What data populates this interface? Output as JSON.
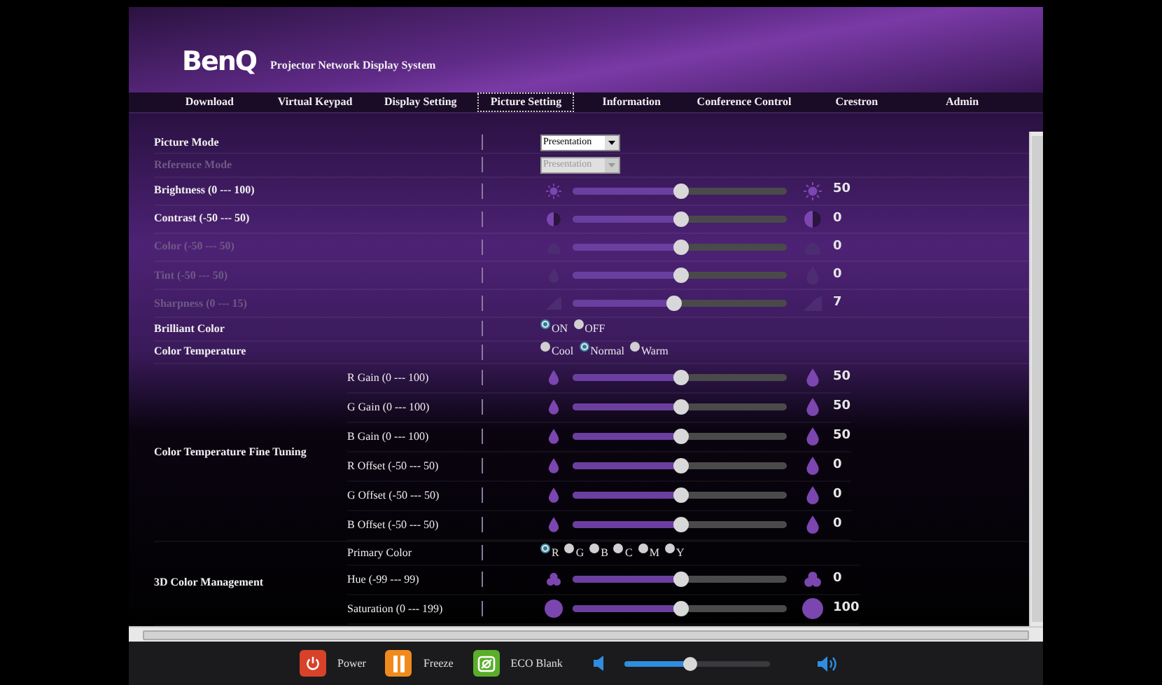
{
  "header": {
    "logo": "BenQ",
    "subtitle": "Projector Network Display System"
  },
  "tabs": [
    {
      "label": "Download",
      "selected": false
    },
    {
      "label": "Virtual Keypad",
      "selected": false
    },
    {
      "label": "Display Setting",
      "selected": false
    },
    {
      "label": "Picture Setting",
      "selected": true
    },
    {
      "label": "Information",
      "selected": false
    },
    {
      "label": "Conference Control",
      "selected": false
    },
    {
      "label": "Crestron",
      "selected": false
    },
    {
      "label": "Admin",
      "selected": false
    }
  ],
  "rows": [
    {
      "kind": "select",
      "label": "Picture Mode",
      "value": "Presentation",
      "disabled": false
    },
    {
      "kind": "select",
      "label": "Reference Mode",
      "value": "Presentation",
      "disabled": true
    },
    {
      "kind": "brightness",
      "label": "Brightness (0 --- 100)",
      "level": 0.5,
      "reading": "50",
      "disabled": false
    },
    {
      "kind": "contrast",
      "label": "Contrast (-50 --- 50)",
      "level": 0.5,
      "reading": "0",
      "disabled": false
    },
    {
      "kind": "color",
      "label": "Color (-50 --- 50)",
      "level": 0.5,
      "reading": "0",
      "disabled": true
    },
    {
      "kind": "tint",
      "label": "Tint (-50 --- 50)",
      "level": 0.5,
      "reading": "0",
      "disabled": true
    },
    {
      "kind": "sharpness",
      "label": "Sharpness (0 --- 15)",
      "level": 0.47,
      "reading": "7",
      "disabled": true
    },
    {
      "kind": "radio",
      "label": "Brilliant Color",
      "options": [
        {
          "label": "ON",
          "selected": true
        },
        {
          "label": "OFF",
          "selected": false
        }
      ]
    },
    {
      "kind": "radio",
      "label": "Color Temperature",
      "options": [
        {
          "label": "Cool",
          "selected": false
        },
        {
          "label": "Normal",
          "selected": true
        },
        {
          "label": "Warm",
          "selected": false
        }
      ]
    },
    {
      "kind": "group",
      "label": "Color Temperature Fine Tuning",
      "children": [
        {
          "kind": "tint",
          "label": "R Gain (0 --- 100)",
          "level": 0.5,
          "reading": "50",
          "disabled": false
        },
        {
          "kind": "tint",
          "label": "G Gain (0 --- 100)",
          "level": 0.5,
          "reading": "50",
          "disabled": false
        },
        {
          "kind": "tint",
          "label": "B Gain (0 --- 100)",
          "level": 0.5,
          "reading": "50",
          "disabled": false
        },
        {
          "kind": "tint",
          "label": "R Offset (-50 --- 50)",
          "level": 0.5,
          "reading": "0",
          "disabled": false
        },
        {
          "kind": "tint",
          "label": "G Offset (-50 --- 50)",
          "level": 0.5,
          "reading": "0",
          "disabled": false
        },
        {
          "kind": "tint",
          "label": "B Offset (-50 --- 50)",
          "level": 0.5,
          "reading": "0",
          "disabled": false
        }
      ]
    },
    {
      "kind": "group",
      "label": "3D Color Management",
      "children": [
        {
          "kind": "radio",
          "label": "Primary Color",
          "options": [
            {
              "label": "R",
              "selected": true
            },
            {
              "label": "G",
              "selected": false
            },
            {
              "label": "B",
              "selected": false
            },
            {
              "label": "C",
              "selected": false
            },
            {
              "label": "M",
              "selected": false
            },
            {
              "label": "Y",
              "selected": false
            }
          ]
        },
        {
          "kind": "hue",
          "label": "Hue (-99 --- 99)",
          "level": 0.5,
          "reading": "0",
          "disabled": false
        },
        {
          "kind": "saturation",
          "label": "Saturation (0 --- 199)",
          "level": 0.5,
          "reading": "100",
          "disabled": false
        }
      ]
    }
  ],
  "controls": [
    {
      "kind": "power",
      "label": "Power"
    },
    {
      "kind": "freeze",
      "label": "Freeze"
    },
    {
      "kind": "eco",
      "label": "ECO Blank"
    }
  ],
  "volume": {
    "level": 0.45
  }
}
